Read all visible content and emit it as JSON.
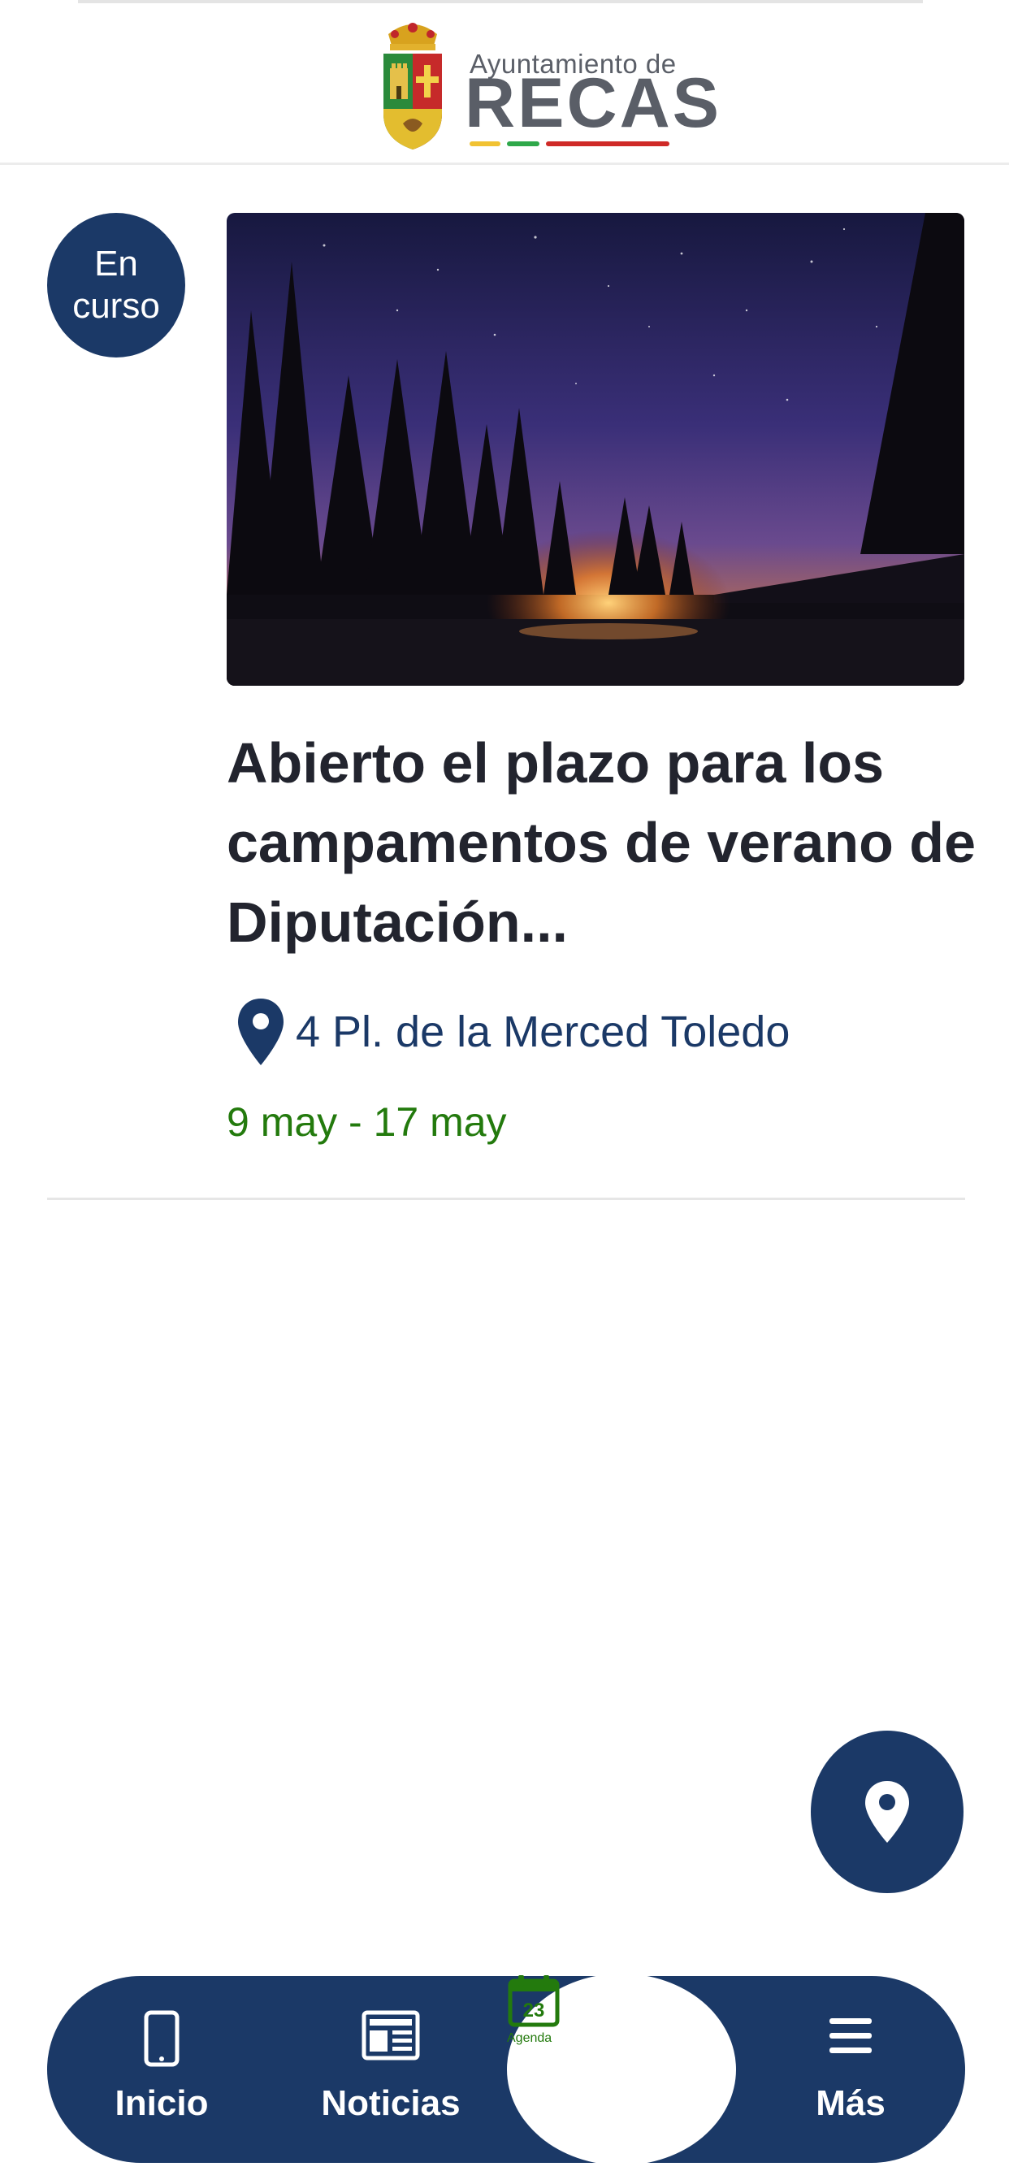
{
  "header": {
    "logo_subtitle": "Ayuntamiento de",
    "logo_title": "RECAS",
    "logo_stripe_colors": [
      "#f1c232",
      "#2ea84a",
      "#cf2a27"
    ]
  },
  "event": {
    "status": "En curso",
    "image_icon": "night-forest-campfire-photo",
    "title": "Abierto el plazo para los campamentos de verano de Diputación...",
    "location_icon": "map-pin-icon",
    "location": "4 Pl. de la Merced Toledo",
    "dates": "9 may - 17 may"
  },
  "map_button": {
    "icon": "map-pin-icon"
  },
  "nav": {
    "items": [
      {
        "label": "Inicio",
        "icon": "smartphone-icon"
      },
      {
        "label": "Noticias",
        "icon": "newspaper-icon"
      },
      {
        "label": "Agenda",
        "icon": "calendar-icon",
        "icon_text": "23",
        "active": true
      },
      {
        "label": "Más",
        "icon": "hamburger-menu-icon"
      }
    ]
  },
  "colors": {
    "brand_navy": "#1b3967",
    "accent_green": "#237a0d",
    "title_text": "#22242e"
  }
}
